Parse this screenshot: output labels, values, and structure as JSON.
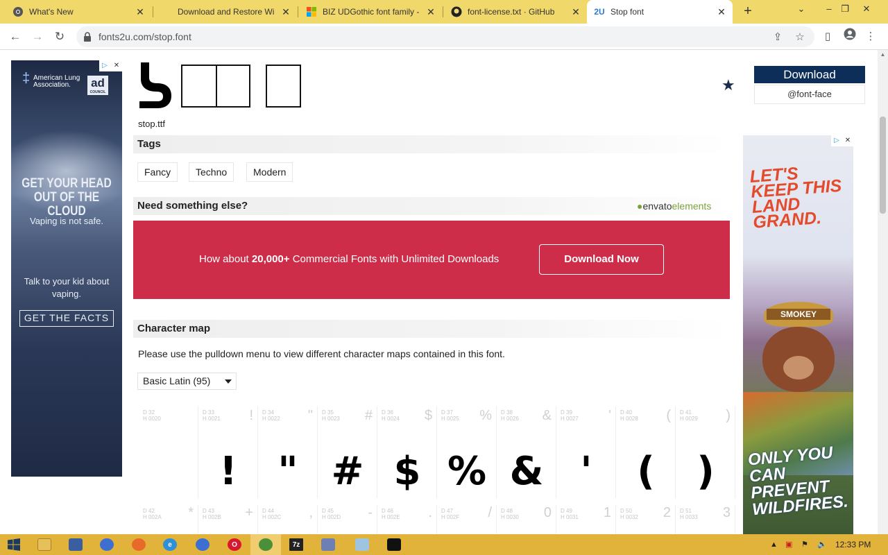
{
  "browser": {
    "tabs": [
      {
        "title": "What's New",
        "icon": "chrome-icon"
      },
      {
        "title": "Download and Restore Wi",
        "icon": "page-icon"
      },
      {
        "title": "BIZ UDGothic font family -",
        "icon": "microsoft-icon"
      },
      {
        "title": "font-license.txt · GitHub",
        "icon": "github-icon"
      },
      {
        "title": "Stop font",
        "icon": "fonts2u-icon",
        "favicon_text": "2U"
      }
    ],
    "url": "fonts2u.com/stop.font"
  },
  "font": {
    "filename": "stop.ttf",
    "download_label": "Download",
    "fontface_label": "@font-face"
  },
  "tags": {
    "heading": "Tags",
    "items": [
      "Fancy",
      "Techno",
      "Modern"
    ]
  },
  "promo": {
    "heading": "Need something else?",
    "brand_prefix": "envato",
    "brand_suffix": "elements",
    "text_before": "How about ",
    "text_bold": "20,000+",
    "text_after": " Commercial Fonts with Unlimited Downloads",
    "button": "Download Now"
  },
  "charmap": {
    "heading": "Character map",
    "description": "Please use the pulldown menu to view different character maps contained in this font.",
    "selected_map": "Basic Latin (95)",
    "row1": [
      {
        "d": "D 32",
        "h": "H 0020",
        "sym": "",
        "glyph": ""
      },
      {
        "d": "D 33",
        "h": "H 0021",
        "sym": "!",
        "glyph": "!"
      },
      {
        "d": "D 34",
        "h": "H 0022",
        "sym": "\"",
        "glyph": "\""
      },
      {
        "d": "D 35",
        "h": "H 0023",
        "sym": "#",
        "glyph": "#"
      },
      {
        "d": "D 36",
        "h": "H 0024",
        "sym": "$",
        "glyph": "$"
      },
      {
        "d": "D 37",
        "h": "H 0025",
        "sym": "%",
        "glyph": "%"
      },
      {
        "d": "D 38",
        "h": "H 0026",
        "sym": "&",
        "glyph": "&"
      },
      {
        "d": "D 39",
        "h": "H 0027",
        "sym": "'",
        "glyph": "'"
      },
      {
        "d": "D 40",
        "h": "H 0028",
        "sym": "(",
        "glyph": "("
      },
      {
        "d": "D 41",
        "h": "H 0029",
        "sym": ")",
        "glyph": ")"
      }
    ],
    "row2": [
      {
        "d": "D 42",
        "h": "H 002A",
        "sym": "*"
      },
      {
        "d": "D 43",
        "h": "H 002B",
        "sym": "+"
      },
      {
        "d": "D 44",
        "h": "H 002C",
        "sym": ","
      },
      {
        "d": "D 45",
        "h": "H 002D",
        "sym": "-"
      },
      {
        "d": "D 46",
        "h": "H 002E",
        "sym": "."
      },
      {
        "d": "D 47",
        "h": "H 002F",
        "sym": "/"
      },
      {
        "d": "D 48",
        "h": "H 0030",
        "sym": "0"
      },
      {
        "d": "D 49",
        "h": "H 0031",
        "sym": "1"
      },
      {
        "d": "D 50",
        "h": "H 0032",
        "sym": "2"
      },
      {
        "d": "D 51",
        "h": "H 0033",
        "sym": "3"
      }
    ]
  },
  "ads": {
    "left": {
      "org": "American Lung Association.",
      "badge": "ad",
      "badge_small": "COUNCIL",
      "headline": "GET YOUR HEAD OUT OF THE CLOUD",
      "subline": "Vaping is not safe.",
      "body": "Talk to your kid about vaping.",
      "cta": "GET THE FACTS"
    },
    "right": {
      "headline": "LET'S KEEP THIS LAND GRAND.",
      "hat": "SMOKEY",
      "tagline": "ONLY YOU CAN PREVENT WILDFIRES."
    }
  },
  "taskbar": {
    "time": "12:33 PM"
  },
  "colors": {
    "tab_strip": "#f1d86b",
    "taskbar": "#e2b33a",
    "download_button": "#0e2e5a",
    "promo_banner": "#cd2d48",
    "envato_green": "#7aa23c"
  }
}
